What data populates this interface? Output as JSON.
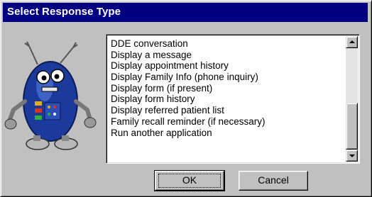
{
  "window": {
    "title": "Select Response Type"
  },
  "list": {
    "items": [
      "DDE conversation",
      "Display a message",
      "Display appointment history",
      "Display Family Info (phone inquiry)",
      "Display form (if present)",
      "Display form history",
      "Display referred patient list",
      "Family recall reminder (if necessary)",
      "Run another application"
    ]
  },
  "buttons": {
    "ok": "OK",
    "cancel": "Cancel"
  },
  "icons": {
    "mascot": "robot-mascot-icon",
    "scroll_up": "scroll-up-arrow-icon",
    "scroll_down": "scroll-down-arrow-icon"
  },
  "colors": {
    "titlebar": "#000080",
    "face": "#c0c0c0",
    "robot_body": "#1c3a9c"
  }
}
